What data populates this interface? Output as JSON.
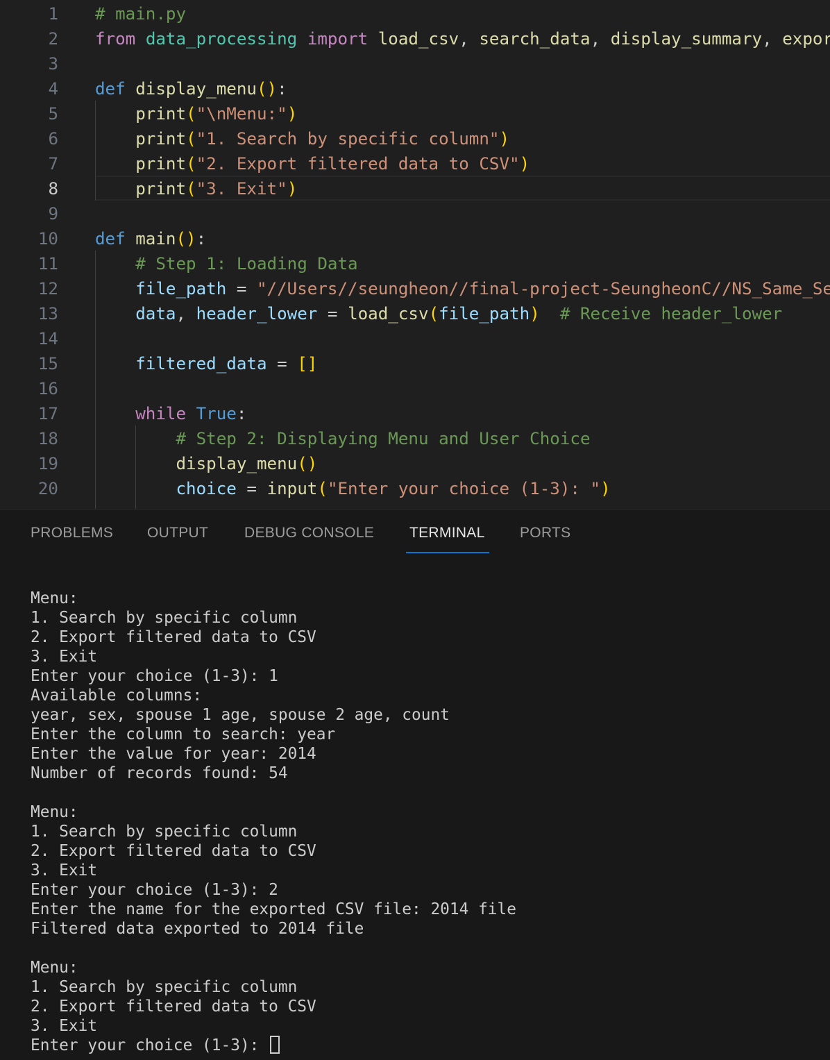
{
  "editor": {
    "lines": [
      {
        "num": "1",
        "tokens": [
          {
            "t": "# main.py",
            "c": "cm"
          }
        ]
      },
      {
        "num": "2",
        "tokens": [
          {
            "t": "from",
            "c": "kw-ctrl"
          },
          {
            "t": " ",
            "c": "plain"
          },
          {
            "t": "data_processing",
            "c": "mod"
          },
          {
            "t": " ",
            "c": "plain"
          },
          {
            "t": "import",
            "c": "kw-ctrl"
          },
          {
            "t": " ",
            "c": "plain"
          },
          {
            "t": "load_csv",
            "c": "fn"
          },
          {
            "t": ", ",
            "c": "plain"
          },
          {
            "t": "search_data",
            "c": "fn"
          },
          {
            "t": ", ",
            "c": "plain"
          },
          {
            "t": "display_summary",
            "c": "fn"
          },
          {
            "t": ", ",
            "c": "plain"
          },
          {
            "t": "export",
            "c": "fn"
          }
        ]
      },
      {
        "num": "3",
        "tokens": []
      },
      {
        "num": "4",
        "tokens": [
          {
            "t": "def",
            "c": "kw"
          },
          {
            "t": " ",
            "c": "plain"
          },
          {
            "t": "display_menu",
            "c": "fn"
          },
          {
            "t": "()",
            "c": "br1"
          },
          {
            "t": ":",
            "c": "plain"
          }
        ]
      },
      {
        "num": "5",
        "tokens": [
          {
            "t": "    "
          },
          {
            "t": "print",
            "c": "fn"
          },
          {
            "t": "(",
            "c": "br1"
          },
          {
            "t": "\"\\nMenu:\"",
            "c": "str"
          },
          {
            "t": ")",
            "c": "br1"
          }
        ]
      },
      {
        "num": "6",
        "tokens": [
          {
            "t": "    "
          },
          {
            "t": "print",
            "c": "fn"
          },
          {
            "t": "(",
            "c": "br1"
          },
          {
            "t": "\"1. Search by specific column\"",
            "c": "str"
          },
          {
            "t": ")",
            "c": "br1"
          }
        ]
      },
      {
        "num": "7",
        "tokens": [
          {
            "t": "    "
          },
          {
            "t": "print",
            "c": "fn"
          },
          {
            "t": "(",
            "c": "br1"
          },
          {
            "t": "\"2. Export filtered data to CSV\"",
            "c": "str"
          },
          {
            "t": ")",
            "c": "br1"
          }
        ]
      },
      {
        "num": "8",
        "tokens": [
          {
            "t": "    "
          },
          {
            "t": "print",
            "c": "fn"
          },
          {
            "t": "(",
            "c": "br1"
          },
          {
            "t": "\"3. Exit\"",
            "c": "str"
          },
          {
            "t": ")",
            "c": "br1"
          }
        ]
      },
      {
        "num": "9",
        "tokens": []
      },
      {
        "num": "10",
        "tokens": [
          {
            "t": "def",
            "c": "kw"
          },
          {
            "t": " ",
            "c": "plain"
          },
          {
            "t": "main",
            "c": "fn"
          },
          {
            "t": "()",
            "c": "br1"
          },
          {
            "t": ":",
            "c": "plain"
          }
        ]
      },
      {
        "num": "11",
        "tokens": [
          {
            "t": "    "
          },
          {
            "t": "# Step 1: Loading Data",
            "c": "cm"
          }
        ]
      },
      {
        "num": "12",
        "tokens": [
          {
            "t": "    "
          },
          {
            "t": "file_path",
            "c": "var"
          },
          {
            "t": " = ",
            "c": "plain"
          },
          {
            "t": "\"//Users//seungheon//final-project-SeungheonC//NS_Same_Sex",
            "c": "str"
          }
        ]
      },
      {
        "num": "13",
        "tokens": [
          {
            "t": "    "
          },
          {
            "t": "data",
            "c": "var"
          },
          {
            "t": ", ",
            "c": "plain"
          },
          {
            "t": "header_lower",
            "c": "var"
          },
          {
            "t": " = ",
            "c": "plain"
          },
          {
            "t": "load_csv",
            "c": "fn"
          },
          {
            "t": "(",
            "c": "br1"
          },
          {
            "t": "file_path",
            "c": "var"
          },
          {
            "t": ")",
            "c": "br1"
          },
          {
            "t": "  ",
            "c": "plain"
          },
          {
            "t": "# Receive header_lower",
            "c": "cm"
          }
        ]
      },
      {
        "num": "14",
        "tokens": []
      },
      {
        "num": "15",
        "tokens": [
          {
            "t": "    "
          },
          {
            "t": "filtered_data",
            "c": "var"
          },
          {
            "t": " = ",
            "c": "plain"
          },
          {
            "t": "[]",
            "c": "br1"
          }
        ]
      },
      {
        "num": "16",
        "tokens": []
      },
      {
        "num": "17",
        "tokens": [
          {
            "t": "    "
          },
          {
            "t": "while",
            "c": "kw-ctrl"
          },
          {
            "t": " ",
            "c": "plain"
          },
          {
            "t": "True",
            "c": "kw"
          },
          {
            "t": ":",
            "c": "plain"
          }
        ]
      },
      {
        "num": "18",
        "tokens": [
          {
            "t": "        "
          },
          {
            "t": "# Step 2: Displaying Menu and User Choice",
            "c": "cm"
          }
        ]
      },
      {
        "num": "19",
        "tokens": [
          {
            "t": "        "
          },
          {
            "t": "display_menu",
            "c": "fn"
          },
          {
            "t": "()",
            "c": "br1"
          }
        ]
      },
      {
        "num": "20",
        "tokens": [
          {
            "t": "        "
          },
          {
            "t": "choice",
            "c": "var"
          },
          {
            "t": " = ",
            "c": "plain"
          },
          {
            "t": "input",
            "c": "fn"
          },
          {
            "t": "(",
            "c": "br1"
          },
          {
            "t": "\"Enter your choice (1-3): \"",
            "c": "str"
          },
          {
            "t": ")",
            "c": "br1"
          }
        ]
      }
    ],
    "active_line": "8"
  },
  "panel": {
    "tabs": [
      "PROBLEMS",
      "OUTPUT",
      "DEBUG CONSOLE",
      "TERMINAL",
      "PORTS"
    ],
    "active_tab": "TERMINAL"
  },
  "terminal": {
    "lines": [
      "Menu:",
      "1. Search by specific column",
      "2. Export filtered data to CSV",
      "3. Exit",
      "Enter your choice (1-3): 1",
      "Available columns:",
      "year, sex, spouse 1 age, spouse 2 age, count",
      "Enter the column to search: year",
      "Enter the value for year: 2014",
      "Number of records found: 54",
      "",
      "Menu:",
      "1. Search by specific column",
      "2. Export filtered data to CSV",
      "3. Exit",
      "Enter your choice (1-3): 2",
      "Enter the name for the exported CSV file: 2014 file",
      "Filtered data exported to 2014 file",
      "",
      "Menu:",
      "1. Search by specific column",
      "2. Export filtered data to CSV",
      "3. Exit"
    ],
    "prompt": "Enter your choice (1-3): "
  }
}
